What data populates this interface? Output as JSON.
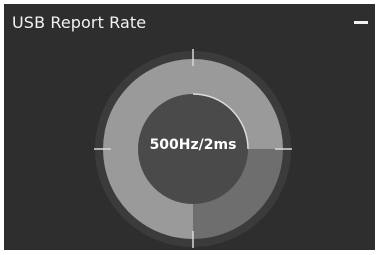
{
  "panel": {
    "title": "USB Report Rate",
    "collapse_icon": "minus-icon"
  },
  "dial": {
    "current_value": "500Hz/2ms",
    "level_fraction": 0.75
  },
  "colors": {
    "background": "#2e2e2e",
    "outer_track": "#3b3b3b",
    "ring_active": "#9a9a9a",
    "ring_dim": "#6e6e6e",
    "center": "#4a4a4a",
    "text": "#ffffff"
  }
}
